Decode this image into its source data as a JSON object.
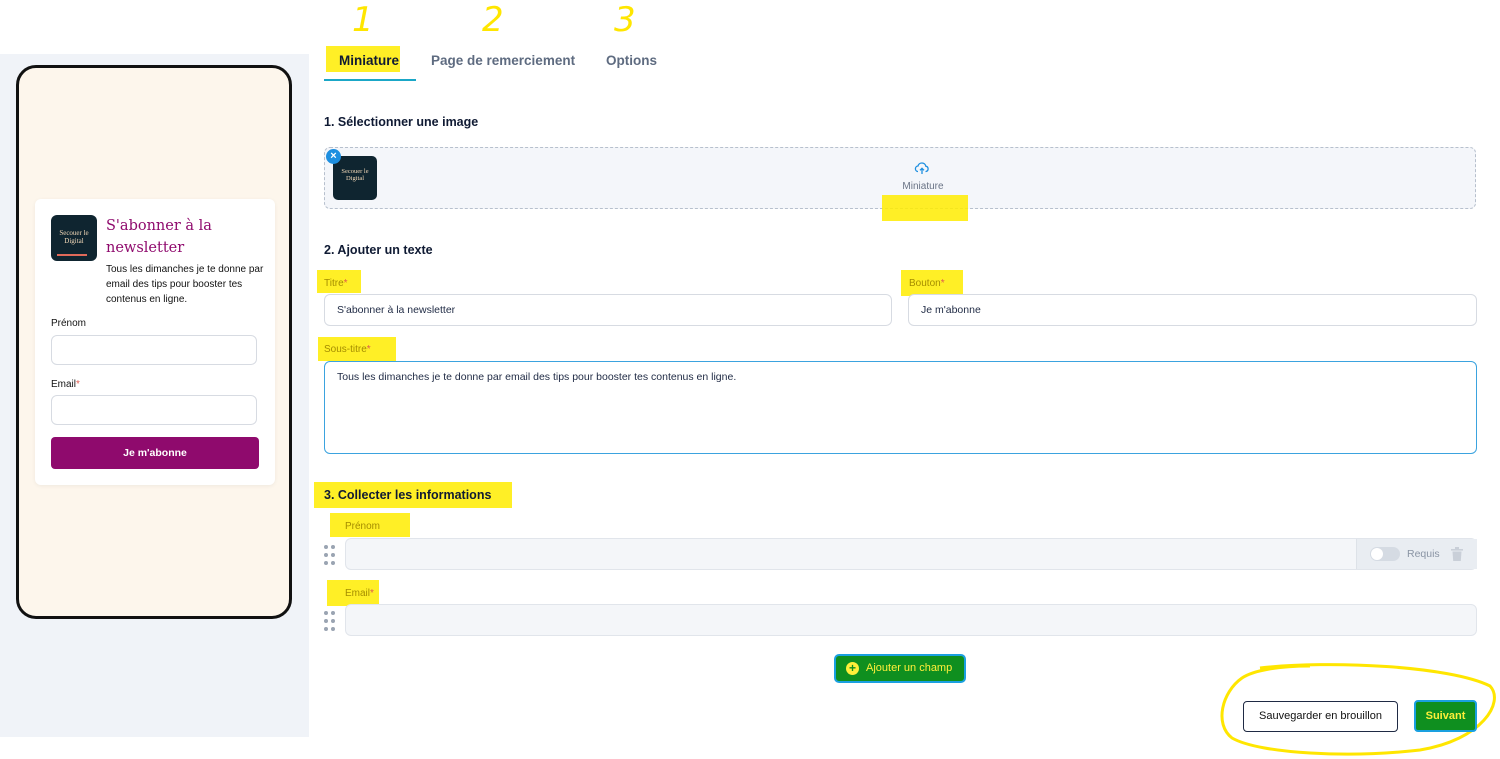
{
  "preview": {
    "brand_logo_text": "Secouer le Digital",
    "title": "S'abonner à la newsletter",
    "subtitle": "Tous les dimanches je te donne par email des tips pour booster tes contenus en ligne.",
    "fields": [
      {
        "label": "Prénom",
        "required": false
      },
      {
        "label": "Email",
        "required": true
      }
    ],
    "button_label": "Je m'abonne",
    "required_mark": "*"
  },
  "annotations": {
    "step1": "1",
    "step2": "2",
    "step3": "3"
  },
  "tabs": [
    {
      "label": "Miniature",
      "active": true
    },
    {
      "label": "Page de remerciement",
      "active": false
    },
    {
      "label": "Options",
      "active": false
    }
  ],
  "section1": {
    "title": "1. Sélectionner une image",
    "dropzone_label": "Miniature"
  },
  "section2": {
    "title": "2. Ajouter un texte",
    "titre_label": "Titre",
    "titre_value": "S'abonner à la newsletter",
    "bouton_label": "Bouton",
    "bouton_value": "Je m'abonne",
    "soustitre_label": "Sous-titre",
    "soustitre_value": "Tous les dimanches je te donne par email des tips pour booster tes contenus en ligne."
  },
  "section3": {
    "title": "3. Collecter les informations",
    "fields": [
      {
        "label": "Prénom",
        "required": false,
        "toggle_label": "Requis"
      },
      {
        "label": "Email",
        "required": true
      }
    ],
    "add_field_label": "Ajouter un champ"
  },
  "actions": {
    "draft_label": "Sauvegarder en brouillon",
    "next_label": "Suivant"
  },
  "colors": {
    "brand": "#8f0a6d",
    "highlight": "#ffec00",
    "accent": "#1aa7c7",
    "button_green": "#0f8f1f"
  }
}
